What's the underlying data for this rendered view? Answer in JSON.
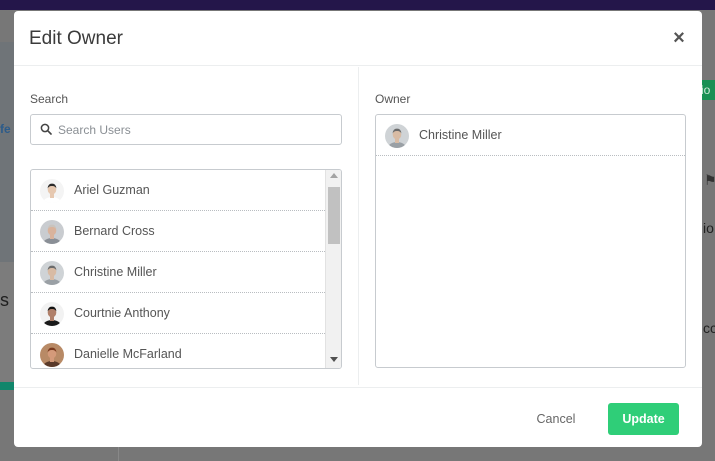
{
  "background": {
    "left_text": "s",
    "left_blue_text": "fe",
    "right_green_text": "io",
    "right_text_1": "io",
    "right_text_2": "cc",
    "right_flag": "⚑"
  },
  "modal": {
    "title": "Edit Owner",
    "close_label": "×",
    "search": {
      "label": "Search",
      "placeholder": "Search Users",
      "value": ""
    },
    "users": [
      {
        "name": "Ariel Guzman",
        "avatar": {
          "skin": "#e6c8b0",
          "hair": "#2a2a2a",
          "shirt": "#ffffff",
          "bg": "#f4f4f4"
        }
      },
      {
        "name": "Bernard Cross",
        "avatar": {
          "skin": "#d9b39c",
          "hair": "#c9c3bd",
          "shirt": "#8a8f96",
          "bg": "#c9ccd0"
        }
      },
      {
        "name": "Christine Miller",
        "avatar": {
          "skin": "#d8bba4",
          "hair": "#6b6b6b",
          "shirt": "#9aa0a5",
          "bg": "#cfd3d6"
        }
      },
      {
        "name": "Courtnie Anthony",
        "avatar": {
          "skin": "#b0806a",
          "hair": "#111111",
          "shirt": "#1a1a1a",
          "bg": "#f2f2f2"
        }
      },
      {
        "name": "Danielle McFarland",
        "avatar": {
          "skin": "#d49a7a",
          "hair": "#7a3a1e",
          "shirt": "#5a3a2a",
          "bg": "#b88a66"
        }
      }
    ],
    "owner": {
      "label": "Owner",
      "selected": [
        {
          "name": "Christine Miller",
          "avatar": {
            "skin": "#d8bba4",
            "hair": "#6b6b6b",
            "shirt": "#9aa0a5",
            "bg": "#cfd3d6"
          }
        }
      ]
    },
    "footer": {
      "cancel_label": "Cancel",
      "update_label": "Update"
    }
  },
  "colors": {
    "accent": "#2fce78",
    "topbar": "#24164a"
  }
}
